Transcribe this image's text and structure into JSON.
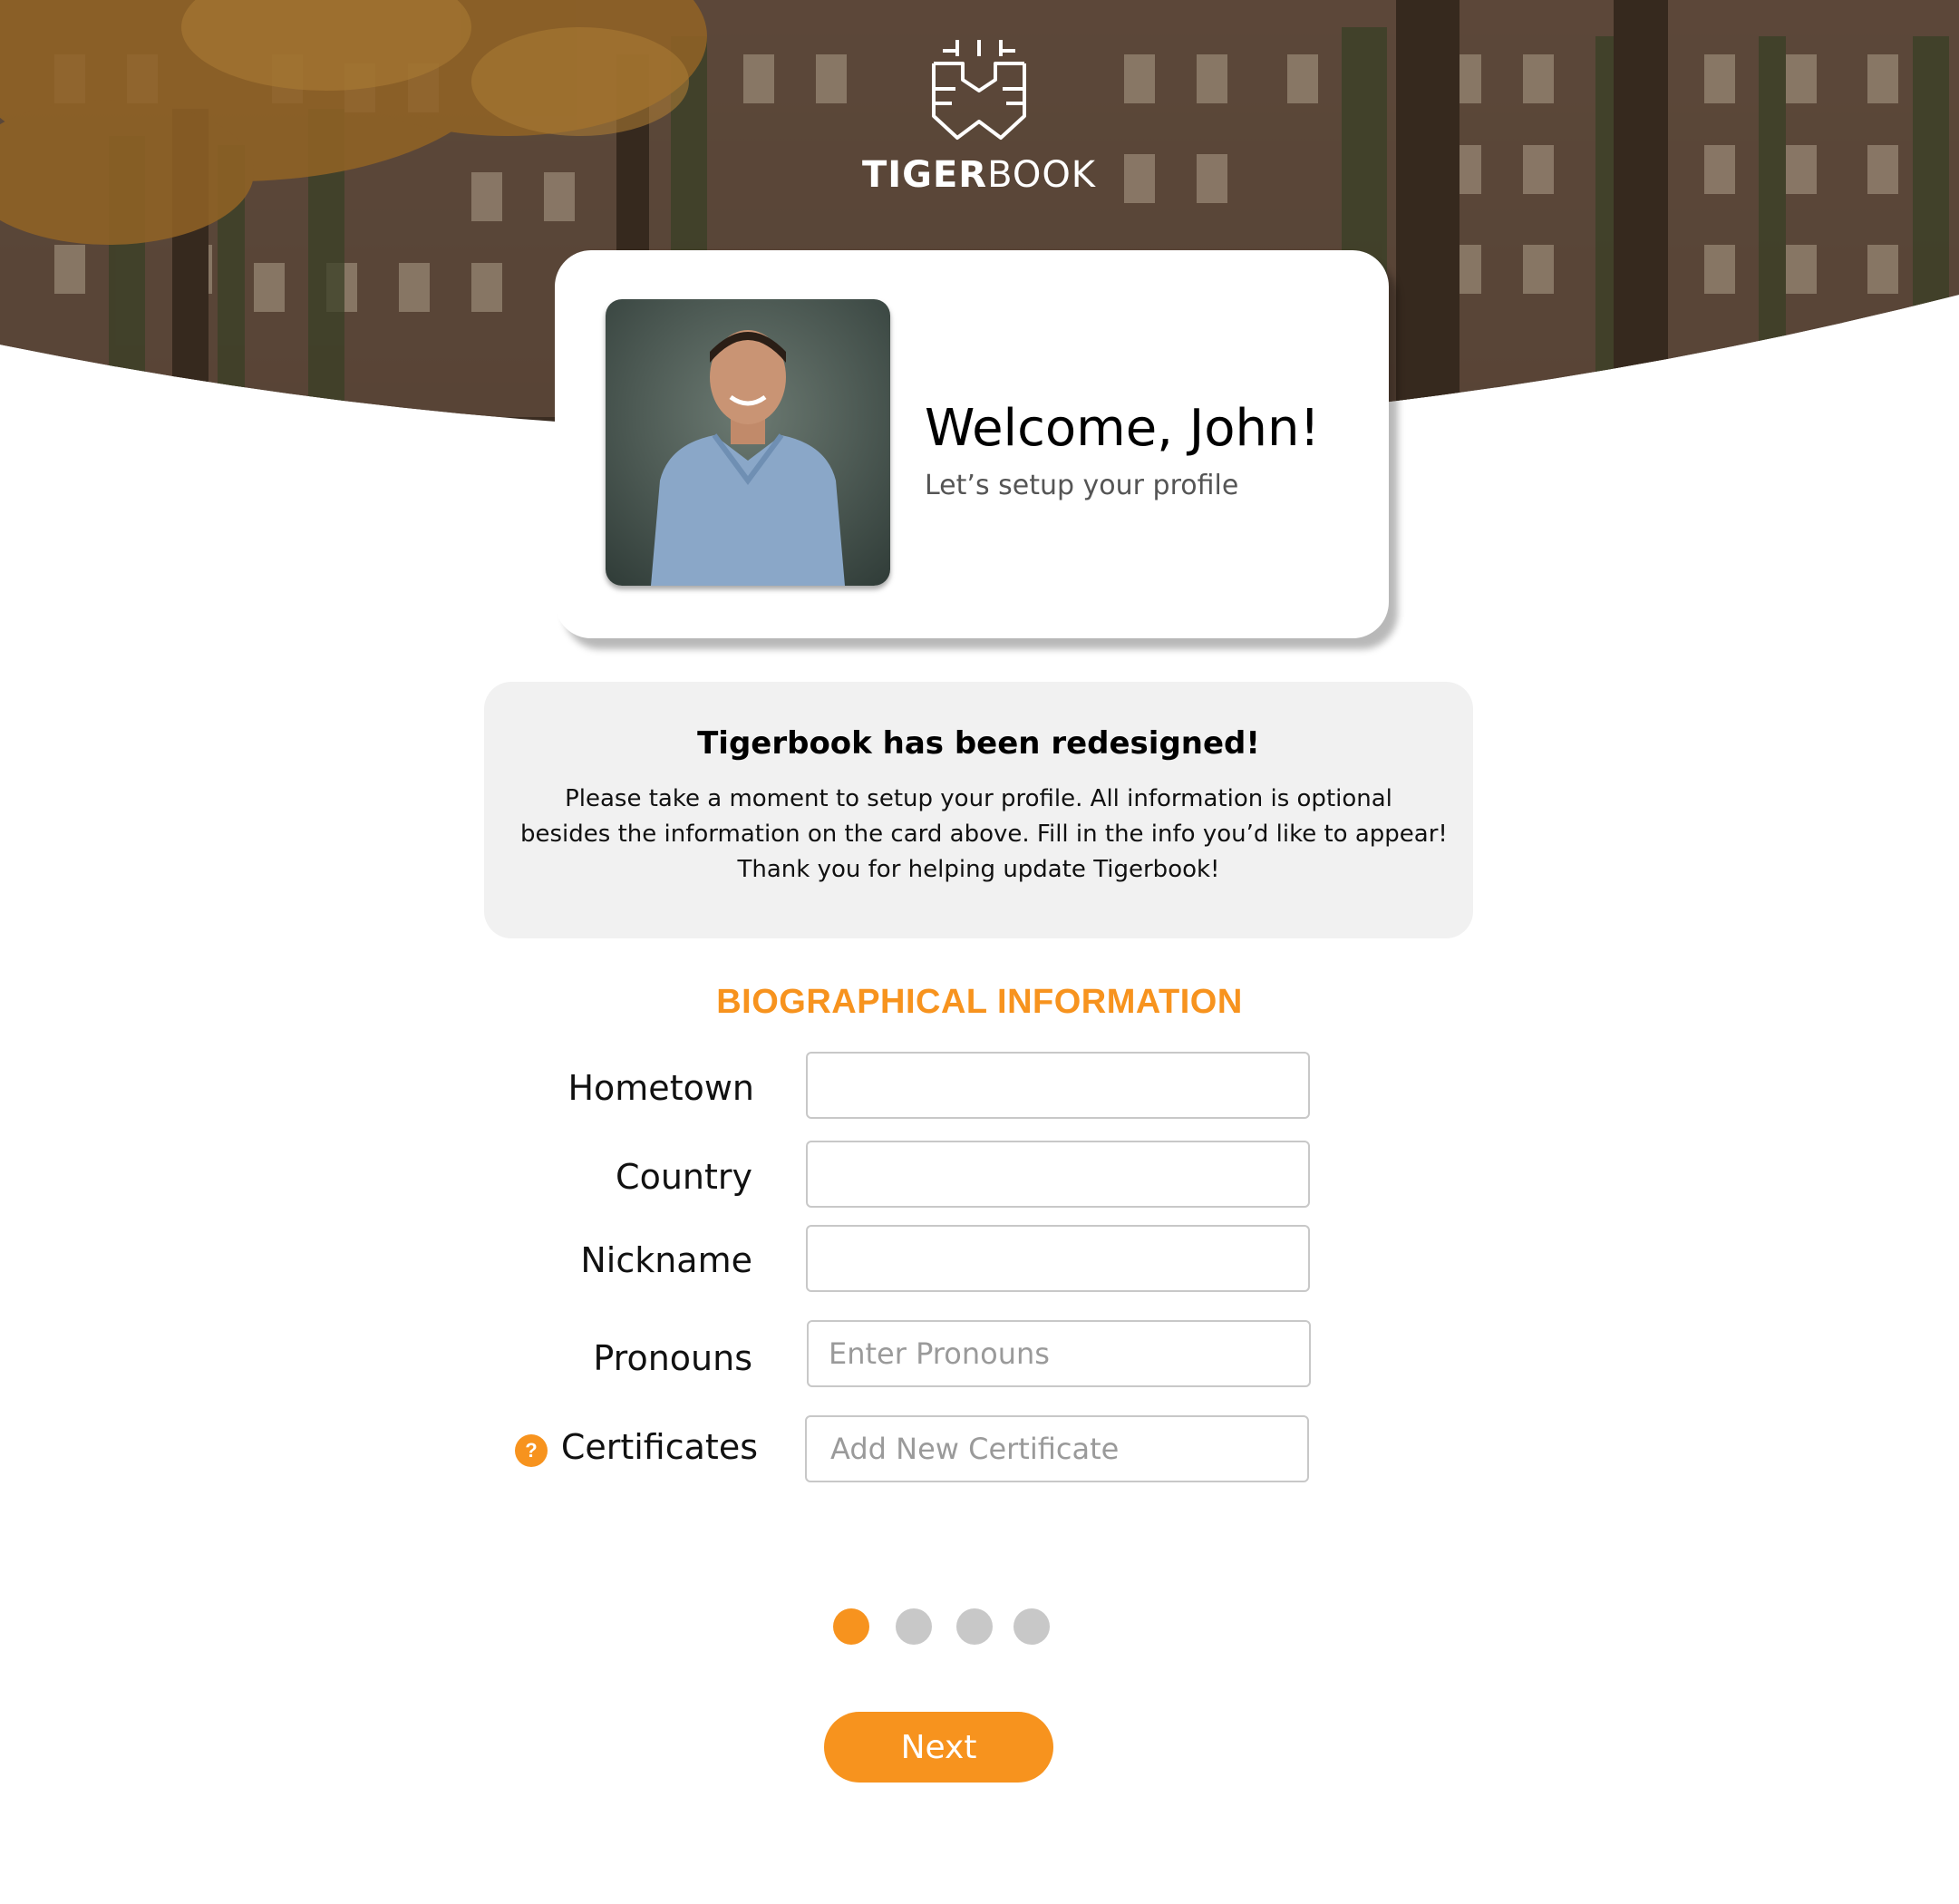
{
  "brand": {
    "name_bold": "TIGER",
    "name_light": "BOOK",
    "accent_color": "#f7931e"
  },
  "welcome": {
    "title": "Welcome, John!",
    "subtitle": "Let’s setup your profile"
  },
  "notice": {
    "title": "Tigerbook has been redesigned!",
    "lines": [
      "Please take a moment to setup your profile. All information is optional",
      "besides the information on the card above. Fill in the info you’d like to appear!",
      "Thank you for helping update Tigerbook!"
    ]
  },
  "form": {
    "section_title": "BIOGRAPHICAL INFORMATION",
    "hometown": {
      "label": "Hometown",
      "value": "",
      "placeholder": ""
    },
    "country": {
      "label": "Country",
      "value": "",
      "placeholder": ""
    },
    "nickname": {
      "label": "Nickname",
      "value": "",
      "placeholder": ""
    },
    "pronouns": {
      "label": "Pronouns",
      "value": "",
      "placeholder": "Enter Pronouns"
    },
    "certificates": {
      "label": "Certificates",
      "value": "",
      "placeholder": "Add New Certificate",
      "help_icon": "question-icon",
      "help_glyph": "?"
    }
  },
  "pagination": {
    "total": 4,
    "current": 1
  },
  "actions": {
    "next_label": "Next"
  }
}
